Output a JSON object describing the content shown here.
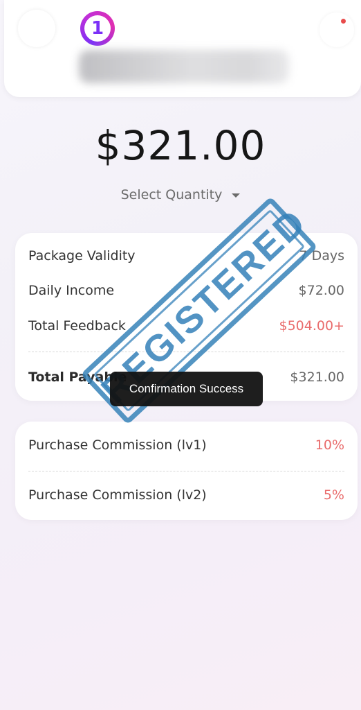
{
  "header": {
    "logo_glyph": "1",
    "notification_color": "#e84b4b",
    "brand_gradient": [
      "#7b2ff7",
      "#e02fb0"
    ]
  },
  "product": {
    "price": "$321.00",
    "quantity_label": "Select Quantity"
  },
  "details": {
    "rows": [
      {
        "label": "Package Validity",
        "value": "7 Days"
      },
      {
        "label": "Daily Income",
        "value": "$72.00"
      },
      {
        "label": "Total Feedback",
        "value": "$504.00+"
      }
    ],
    "total": {
      "label": "Total Payable",
      "value": "$321.00"
    }
  },
  "commission": {
    "rows": [
      {
        "label": "Purchase Commission (lv1)",
        "value": "10%"
      },
      {
        "label": "Purchase Commission (lv2)",
        "value": "5%"
      }
    ]
  },
  "toast": {
    "text": "Confirmation Success"
  },
  "stamp": {
    "text": "REGISTERED",
    "color": "#3682b9"
  },
  "colors": {
    "accent_red": "#e96b6b",
    "toast_bg": "#121212"
  }
}
